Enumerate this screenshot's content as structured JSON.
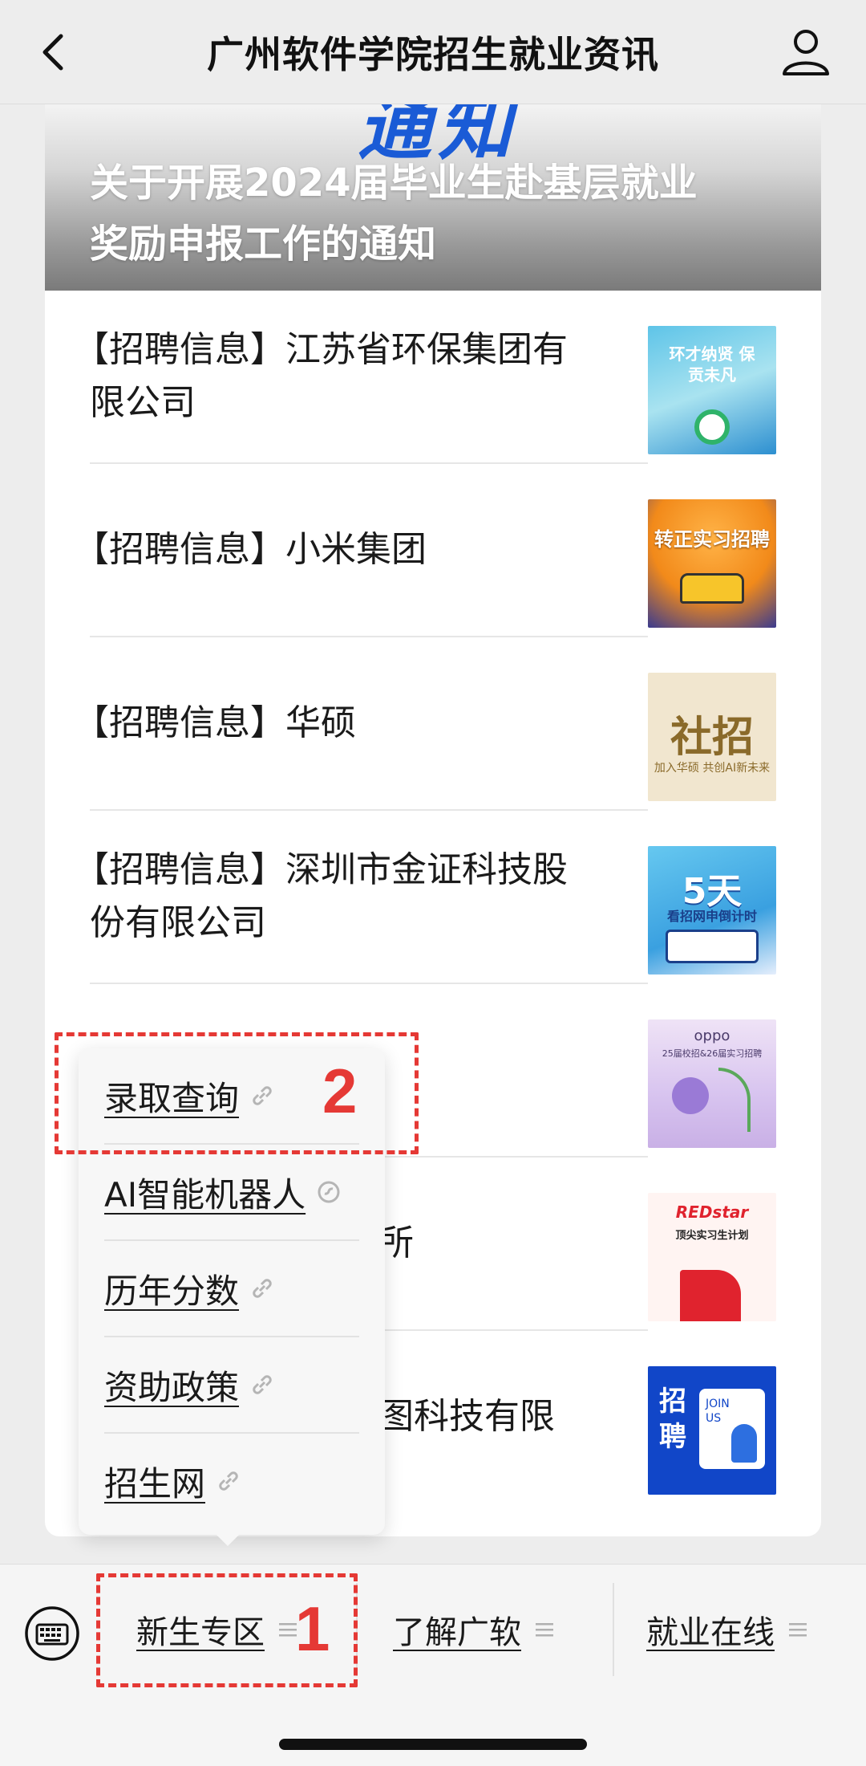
{
  "header": {
    "title": "广州软件学院招生就业资讯"
  },
  "banner": {
    "headline_partial": "通知",
    "title_line1": "关于开展2024届毕业生赴基层就业",
    "title_line2": "奖励申报工作的通知"
  },
  "articles": [
    {
      "title_line1": "【招聘信息】江苏省环保集团有",
      "title_line2": "限公司",
      "thumb_text": "环才纳贤 保贡未凡"
    },
    {
      "title_line1": "【招聘信息】小米集团",
      "title_line2": "",
      "thumb_text": "转正实习招聘"
    },
    {
      "title_line1": "【招聘信息】华硕",
      "title_line2": "",
      "thumb_text": "社招",
      "thumb_sub": "加入华硕 共创AI新未来"
    },
    {
      "title_line1": "【招聘信息】深圳市金证科技股",
      "title_line2": "份有限公司",
      "thumb_text": "5天",
      "thumb_sub": "看招网申倒计时"
    },
    {
      "title_line1": "",
      "title_line2": "",
      "thumb_text": "oppo",
      "thumb_sub": "25届校招&26届实习招聘"
    },
    {
      "title_line1": "",
      "title_line2": "",
      "thumb_partial": "所",
      "thumb_text": "REDstar",
      "thumb_sub": "顶尖实习生计划"
    },
    {
      "title_line1": "",
      "title_line2": "",
      "title_partial": "图科技有限",
      "thumb_text": "招聘",
      "thumb_sub": "JOIN US"
    }
  ],
  "popup_menu": {
    "items": [
      {
        "label": "录取查询"
      },
      {
        "label": "AI智能机器人"
      },
      {
        "label": "历年分数"
      },
      {
        "label": "资助政策"
      },
      {
        "label": "招生网"
      }
    ]
  },
  "bottom_menu": {
    "tabs": [
      {
        "label": "新生专区"
      },
      {
        "label": "了解广软"
      },
      {
        "label": "就业在线"
      }
    ]
  },
  "annotations": {
    "one": "1",
    "two": "2"
  },
  "colors": {
    "annotation_red": "#e53935",
    "banner_blue": "#1a5bd6"
  }
}
